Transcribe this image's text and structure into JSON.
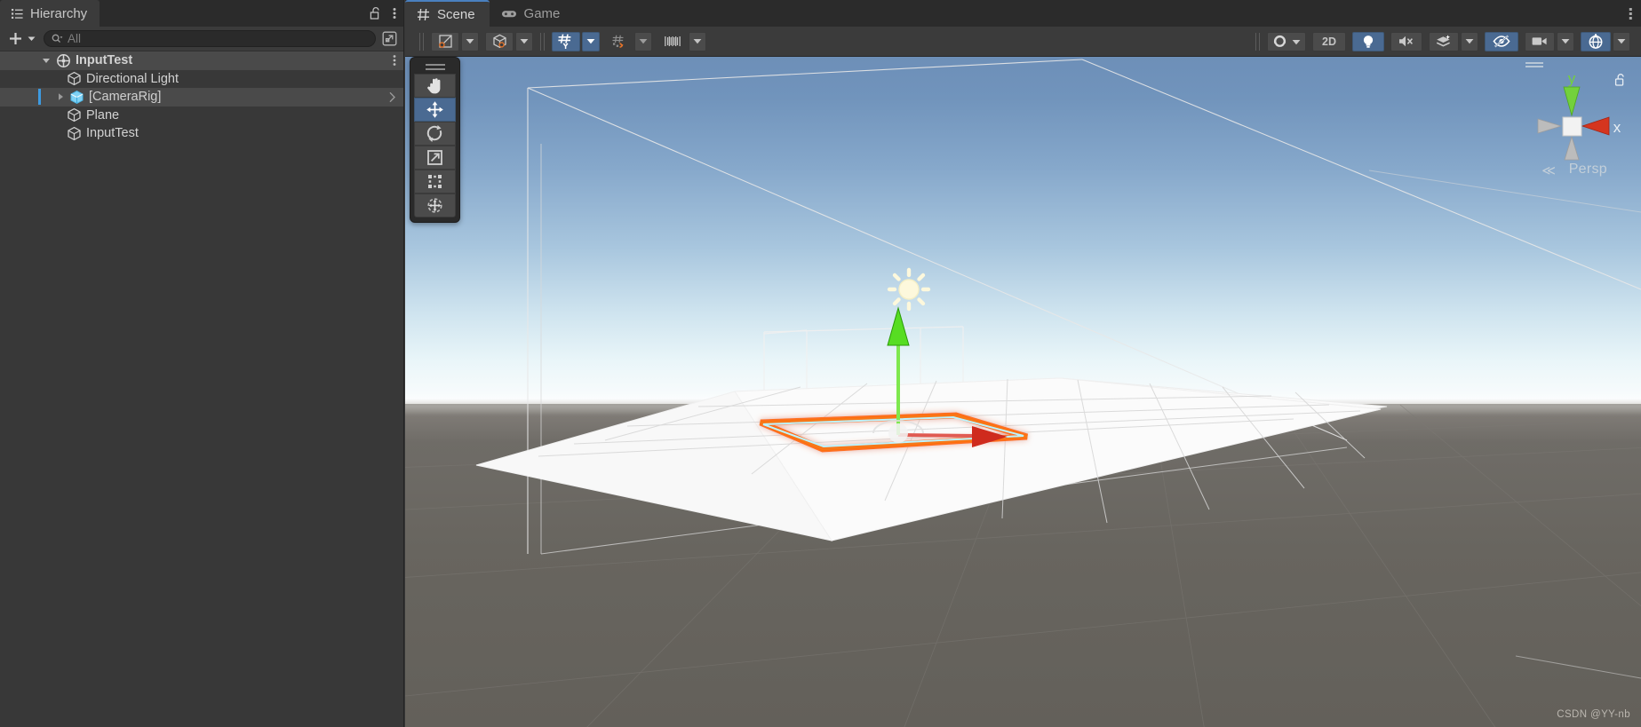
{
  "hierarchy": {
    "tab_label": "Hierarchy",
    "tab_icon": "hierarchy-list-icon",
    "lock_icon": "lock-open-icon",
    "menu_icon": "kebab-menu-icon",
    "toolbar": {
      "add_label": "+",
      "add_icon": "plus-icon",
      "add_caret_icon": "caret-down-icon",
      "search_icon": "search-icon",
      "search_value": "",
      "search_placeholder": "All",
      "detach_icon": "open-in-new-window-icon"
    },
    "rows": [
      {
        "label": "InputTest",
        "icon": "scene-icon",
        "depth": 0,
        "expanded": true,
        "has_arrow": true,
        "selected": false,
        "is_scene": true,
        "kebab": true,
        "chevron": false,
        "prefab": false
      },
      {
        "label": "Directional Light",
        "icon": "gameobject-icon",
        "depth": 1,
        "expanded": false,
        "has_arrow": false,
        "selected": false,
        "is_scene": false,
        "kebab": false,
        "chevron": false,
        "prefab": false
      },
      {
        "label": "[CameraRig]",
        "icon": "prefab-icon",
        "depth": 1,
        "expanded": false,
        "has_arrow": true,
        "selected": true,
        "is_scene": false,
        "kebab": false,
        "chevron": true,
        "prefab": true
      },
      {
        "label": "Plane",
        "icon": "gameobject-icon",
        "depth": 1,
        "expanded": false,
        "has_arrow": false,
        "selected": false,
        "is_scene": false,
        "kebab": false,
        "chevron": false,
        "prefab": false
      },
      {
        "label": "InputTest",
        "icon": "gameobject-icon",
        "depth": 1,
        "expanded": false,
        "has_arrow": false,
        "selected": false,
        "is_scene": false,
        "kebab": false,
        "chevron": false,
        "prefab": false
      }
    ]
  },
  "scene": {
    "tabs": [
      {
        "label": "Scene",
        "icon": "scene-grid-icon",
        "active": true
      },
      {
        "label": "Game",
        "icon": "gamepad-icon",
        "active": false
      }
    ],
    "tabbar_menu_icon": "kebab-menu-icon",
    "toolbar": {
      "left_items": [
        {
          "name": "draw-mode",
          "icon": "shaded-mode-icon",
          "caret": true,
          "active": false
        },
        {
          "name": "shading-mode",
          "icon": "cube-wire-icon",
          "caret": true,
          "active": false
        }
      ],
      "grid_items": [
        {
          "name": "grid-visibility",
          "icon": "grid-y-icon",
          "caret": true,
          "active": true
        },
        {
          "name": "grid-snapping",
          "icon": "grid-magnet-icon",
          "caret": true,
          "active": false
        },
        {
          "name": "snap-increment",
          "icon": "ruler-icon",
          "caret": true,
          "active": false
        }
      ],
      "right_items": [
        {
          "name": "scene-view-camera-mode",
          "icon": "sphere-icon",
          "caret": true,
          "active": false,
          "label": ""
        },
        {
          "name": "toggle-2d",
          "icon": "",
          "caret": false,
          "active": false,
          "label": "2D"
        },
        {
          "name": "toggle-scene-lighting",
          "icon": "lightbulb-icon",
          "caret": false,
          "active": true,
          "label": ""
        },
        {
          "name": "toggle-audio",
          "icon": "speaker-mute-icon",
          "caret": false,
          "active": false,
          "label": ""
        },
        {
          "name": "toggle-fx",
          "icon": "fx-layers-icon",
          "caret": true,
          "active": false,
          "label": ""
        },
        {
          "name": "toggle-gizmos-hidden",
          "icon": "eye-slash-icon",
          "caret": false,
          "active": true,
          "label": ""
        },
        {
          "name": "scene-camera-settings",
          "icon": "video-camera-icon",
          "caret": true,
          "active": false,
          "label": ""
        },
        {
          "name": "toggle-gizmos",
          "icon": "gizmos-globe-icon",
          "caret": true,
          "active": false,
          "label": ""
        }
      ]
    },
    "tool_palette": {
      "grip_icon": "drag-handle-icon",
      "tools": [
        {
          "name": "hand-tool",
          "icon": "hand-icon",
          "active": false
        },
        {
          "name": "move-tool",
          "icon": "move-arrows-icon",
          "active": true
        },
        {
          "name": "rotate-tool",
          "icon": "rotate-icon",
          "active": false
        },
        {
          "name": "scale-tool",
          "icon": "scale-icon",
          "active": false
        },
        {
          "name": "rect-tool",
          "icon": "rect-transform-icon",
          "active": false
        },
        {
          "name": "transform-tool",
          "icon": "transform-icon",
          "active": false
        }
      ]
    },
    "gizmo": {
      "axis_x_label": "x",
      "axis_y_label": "y",
      "projection_label": "Persp",
      "projection_arrow": "≪",
      "lock_icon": "lock-open-icon",
      "grip_icon": "drag-handle-icon",
      "color_x": "#d5351f",
      "color_y": "#73d13c",
      "color_z": "#bcbcbc"
    },
    "objects": {
      "light_gizmo_icon": "sun-light-icon",
      "selection_outline_color": "#ff6a00",
      "selection_inner_color": "#a8f0ff",
      "move_handle_y_color": "#5fe32b",
      "move_handle_x_color": "#d5351f"
    },
    "watermark": "CSDN @YY-nb"
  }
}
